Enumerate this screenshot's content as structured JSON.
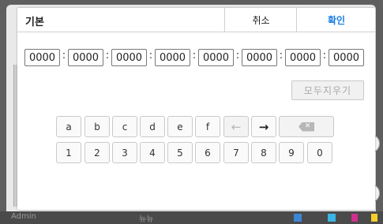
{
  "background": {
    "user_label": "Admin",
    "middle_label": "뉴뉴"
  },
  "dialog": {
    "title": "기본",
    "cancel_label": "취소",
    "ok_label": "확인",
    "fields": [
      "0000",
      "0000",
      "0000",
      "0000",
      "0000",
      "0000",
      "0000",
      "0000"
    ],
    "separator": ":",
    "clear_all_label": "모두지우기"
  },
  "keyboard": {
    "row1": [
      "a",
      "b",
      "c",
      "d",
      "e",
      "f"
    ],
    "row2": [
      "1",
      "2",
      "3",
      "4",
      "5",
      "6",
      "7",
      "8",
      "9",
      "0"
    ],
    "left_arrow": "←",
    "right_arrow": "→",
    "backspace_icon": "backspace-icon"
  }
}
